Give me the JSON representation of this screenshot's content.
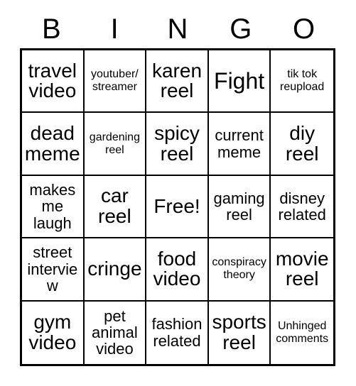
{
  "card": {
    "type": "bingo-card",
    "header_letters": [
      "B",
      "I",
      "N",
      "G",
      "O"
    ],
    "rows": 5,
    "columns": 5,
    "free_space": {
      "row": 3,
      "column": 3,
      "label": "Free!"
    },
    "colors": {
      "background": "#ffffff",
      "text": "#000000",
      "border": "#000000"
    },
    "cells": [
      [
        {
          "text": "travel video",
          "size": "lg"
        },
        {
          "text": "youtuber/ streamer",
          "size": "sm"
        },
        {
          "text": "karen reel",
          "size": "lg"
        },
        {
          "text": "Fight",
          "size": "xl"
        },
        {
          "text": "tik tok reupload",
          "size": "sm"
        }
      ],
      [
        {
          "text": "dead meme",
          "size": "lg"
        },
        {
          "text": "gardening reel",
          "size": "sm"
        },
        {
          "text": "spicy reel",
          "size": "lg"
        },
        {
          "text": "current meme",
          "size": "md"
        },
        {
          "text": "diy reel",
          "size": "lg"
        }
      ],
      [
        {
          "text": "makes me laugh",
          "size": "md"
        },
        {
          "text": "car reel",
          "size": "lg"
        },
        {
          "text": "Free!",
          "size": "lg"
        },
        {
          "text": "gaming reel",
          "size": "md"
        },
        {
          "text": "disney related",
          "size": "md"
        }
      ],
      [
        {
          "text": "street interview",
          "size": "md"
        },
        {
          "text": "cringe",
          "size": "lg"
        },
        {
          "text": "food video",
          "size": "lg"
        },
        {
          "text": "conspiracy theory",
          "size": "sm"
        },
        {
          "text": "movie reel",
          "size": "lg"
        }
      ],
      [
        {
          "text": "gym video",
          "size": "lg"
        },
        {
          "text": "pet animal video",
          "size": "md"
        },
        {
          "text": "fashion related",
          "size": "md"
        },
        {
          "text": "sports reel",
          "size": "lg"
        },
        {
          "text": "Unhinged comments",
          "size": "sm"
        }
      ]
    ]
  }
}
